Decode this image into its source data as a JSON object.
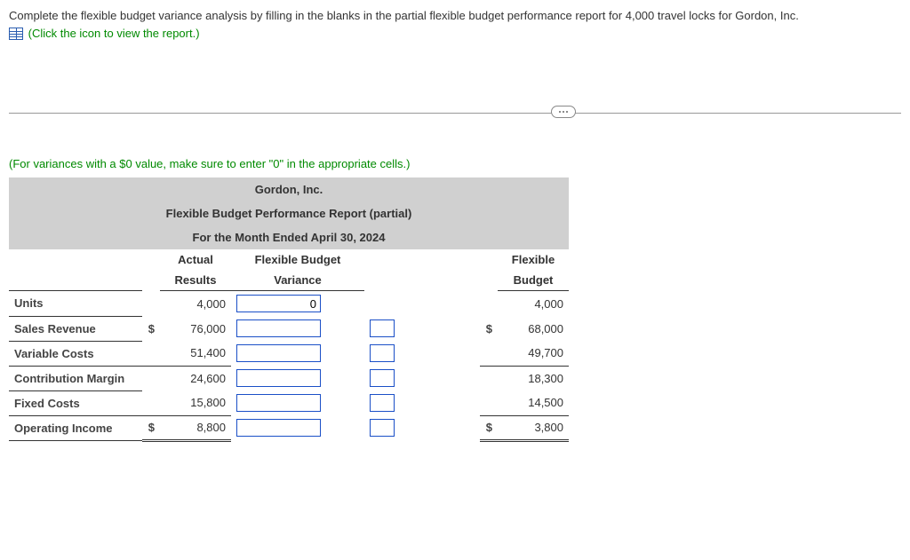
{
  "instructions": {
    "line1": "Complete the flexible budget variance analysis by filling in the blanks in the partial flexible budget performance report for 4,000 travel locks for Gordon, Inc.",
    "linkText": "(Click the icon to view the report.)"
  },
  "notes": {
    "varianceNote": "(For variances with a $0 value, make sure to enter \"0\" in the appropriate cells.)"
  },
  "report": {
    "company": "Gordon, Inc.",
    "title": "Flexible Budget Performance Report (partial)",
    "period": "For the Month Ended April 30, 2024",
    "colHeads": {
      "actual1": "Actual",
      "actual2": "Results",
      "var1": "Flexible Budget",
      "var2": "Variance",
      "flex1": "Flexible",
      "flex2": "Budget"
    },
    "rows": {
      "units": {
        "label": "Units",
        "actual": "4,000",
        "flex": "4,000",
        "varVal": "0",
        "cur": ""
      },
      "sales": {
        "label": "Sales Revenue",
        "actual": "76,000",
        "flex": "68,000",
        "cur": "$"
      },
      "varcost": {
        "label": "Variable Costs",
        "actual": "51,400",
        "flex": "49,700",
        "cur": ""
      },
      "cm": {
        "label": "Contribution Margin",
        "actual": "24,600",
        "flex": "18,300",
        "cur": ""
      },
      "fixed": {
        "label": "Fixed Costs",
        "actual": "15,800",
        "flex": "14,500",
        "cur": ""
      },
      "opinc": {
        "label": "Operating Income",
        "actual": "8,800",
        "flex": "3,800",
        "cur": "$"
      }
    }
  }
}
